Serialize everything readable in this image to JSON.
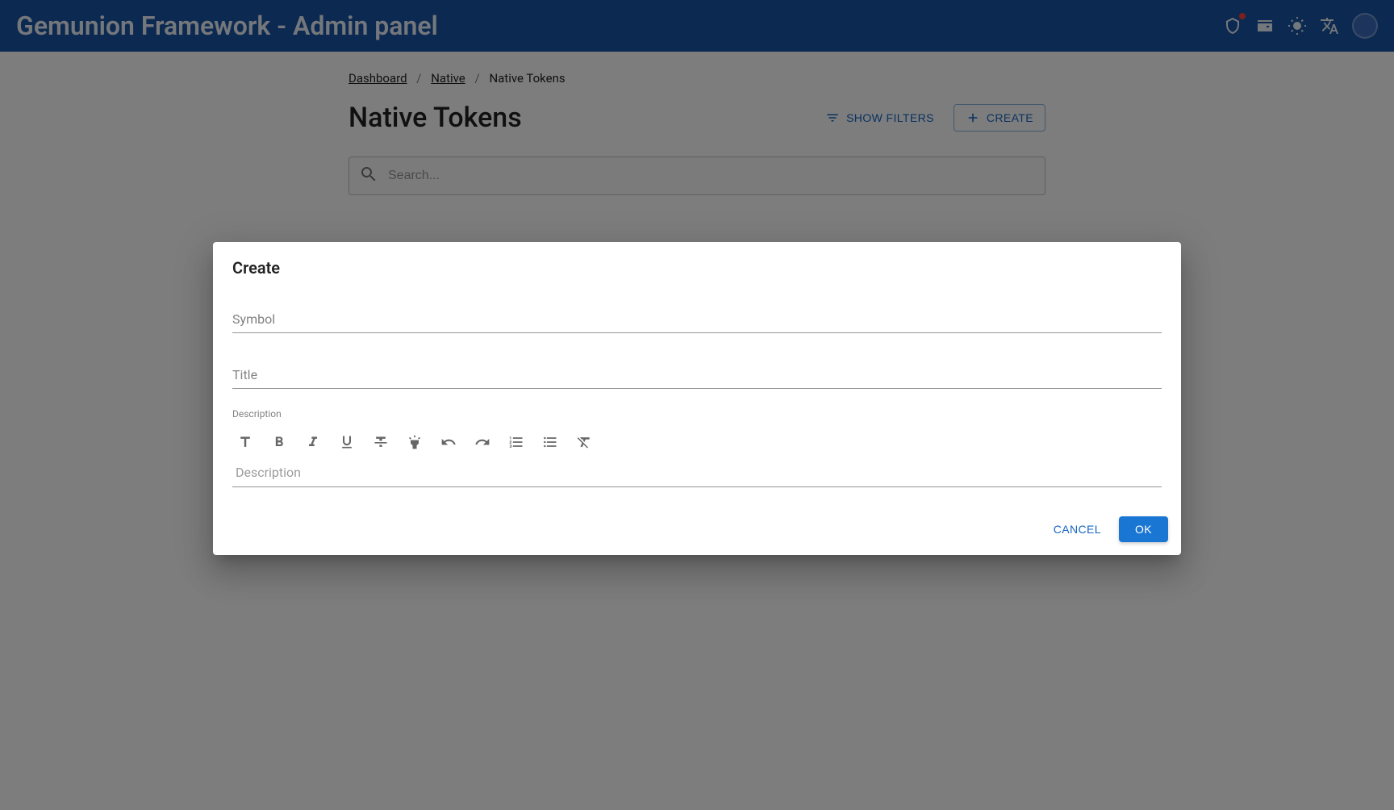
{
  "header": {
    "title": "Gemunion Framework - Admin panel"
  },
  "breadcrumbs": {
    "items": [
      {
        "label": "Dashboard",
        "link": true
      },
      {
        "label": "Native",
        "link": true
      },
      {
        "label": "Native Tokens",
        "link": false
      }
    ]
  },
  "page": {
    "title": "Native Tokens",
    "show_filters_label": "Show Filters",
    "create_label": "Create"
  },
  "search": {
    "placeholder": "Search..."
  },
  "dialog": {
    "title": "Create",
    "fields": {
      "symbol_label": "Symbol",
      "symbol_value": "",
      "title_label": "Title",
      "title_value": "",
      "description_label": "Description",
      "description_placeholder": "Description"
    },
    "actions": {
      "cancel_label": "Cancel",
      "ok_label": "OK"
    }
  }
}
